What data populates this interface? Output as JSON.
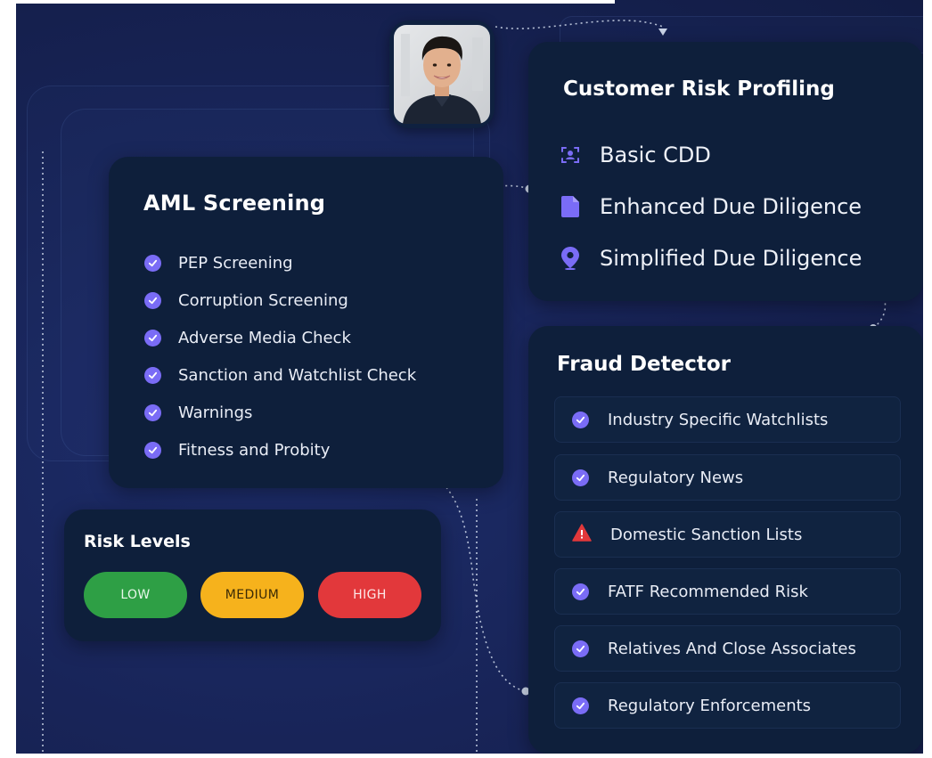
{
  "colors": {
    "accent_check": "#7a6cf6",
    "card_bg": "#0e1f3b",
    "low": "#2e9f45",
    "medium": "#f6b21c",
    "high": "#e2383b",
    "warning": "#e2383b"
  },
  "avatar": {
    "icon": "profile-photo"
  },
  "customer_risk_profiling": {
    "title": "Customer Risk Profiling",
    "items": [
      {
        "label": "Basic CDD",
        "icon": "user-scan-icon"
      },
      {
        "label": "Enhanced Due Diligence",
        "icon": "document-icon"
      },
      {
        "label": "Simplified Due Diligence",
        "icon": "location-pin-icon"
      }
    ]
  },
  "aml_screening": {
    "title": "AML Screening",
    "items": [
      "PEP Screening",
      "Corruption Screening",
      "Adverse Media Check",
      "Sanction and Watchlist Check",
      "Warnings",
      "Fitness and Probity"
    ]
  },
  "fraud_detector": {
    "title": "Fraud Detector",
    "items": [
      {
        "label": "Industry Specific Watchlists",
        "status": "check"
      },
      {
        "label": "Regulatory News",
        "status": "check"
      },
      {
        "label": "Domestic Sanction Lists",
        "status": "warning"
      },
      {
        "label": "FATF Recommended Risk",
        "status": "check"
      },
      {
        "label": "Relatives And Close Associates",
        "status": "check"
      },
      {
        "label": "Regulatory Enforcements",
        "status": "check"
      }
    ]
  },
  "risk_levels": {
    "title": "Risk Levels",
    "low": "LOW",
    "medium": "MEDIUM",
    "high": "HIGH"
  }
}
